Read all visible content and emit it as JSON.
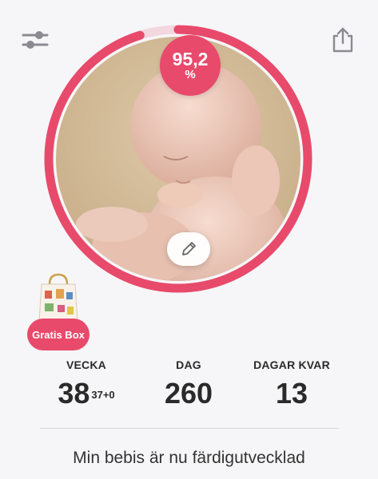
{
  "progress": {
    "value_text": "95,2",
    "unit": "%",
    "fraction": 0.952,
    "accent_color": "#e84a6b",
    "track_color": "#f3d7de"
  },
  "toolbar": {
    "left_icon": "sliders-icon",
    "right_icon": "share-icon"
  },
  "edit_icon": "pencil-icon",
  "gift": {
    "label": "Gratis Box"
  },
  "stats": {
    "week": {
      "label": "VECKA",
      "value": "38",
      "sub": "37+0"
    },
    "day": {
      "label": "DAG",
      "value": "260"
    },
    "days_left": {
      "label": "DAGAR KVAR",
      "value": "13"
    }
  },
  "headline": "Min bebis är nu färdigutvecklad"
}
